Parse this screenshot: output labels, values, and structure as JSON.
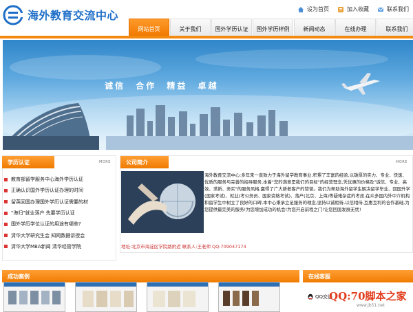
{
  "header": {
    "logo_text": "海外教育交流中心",
    "links": [
      {
        "label": "设为首页",
        "icon": "home-icon"
      },
      {
        "label": "加入收藏",
        "icon": "bookmark-icon"
      },
      {
        "label": "联系我们",
        "icon": "contact-icon"
      }
    ]
  },
  "nav": {
    "items": [
      "网站首页",
      "关于我们",
      "国外学历认证",
      "国外学历样例",
      "新闻动态",
      "在线办理",
      "联系我们"
    ],
    "active_index": 0
  },
  "banner": {
    "slogan": "诚信  合作  精益  卓越"
  },
  "left_module": {
    "title": "学历认证",
    "more": "MORE",
    "items": [
      "教育部留学服务中心海外学历认证",
      "正确认识国外学历认证办理的时间",
      "留英回国办理国外学历认证需要的材",
      "\"海归\"就业落户  先要学历认证",
      "国外学历学位认证的用途有哪些?",
      "清华大学研究生会  知网数据讲授会",
      "清华大学MBA新闻  清华经管学院"
    ]
  },
  "company": {
    "title": "公司简介",
    "more": "MORE",
    "text": "海外教育交流中心:多年来一直致力于海外留学教育事业,积累了丰富的经验,以雄厚的实力、专业、快速、优质的服务与完善的指导服务,本着\"您的满意是我们的目标\"的经营理念,凭优惠的价格及\"诚信、专业、高效、求新、务实\"的服务风格,赢得了广大新老客户的赞誉。我们为帮助海外留学生解决留学毕业、回国升学(国家考试)、就业(考公务员、国家资格考试)、落户(北京、上海)等疑难杂症的考虑,在众多国内外中介机构和留学生中树立了良好的口碑,本中心秉承立足服务的理念,坚持以诚相待,以信相待,互惠互利的合作基础,为您提供最完美的服务!为您增加成功的机会!为您开启前程之门!让您回国发展无忧!",
    "contact": "地址:北京市海淀区学院路附近  联系人:王老师  QQ:709047174"
  },
  "cases": {
    "title": "成功案例"
  },
  "service": {
    "title": "在线客服",
    "qq_label": "QQ交谈"
  },
  "watermark": {
    "text": "QQ:70脚本之家",
    "sub": "www.jb51.net"
  },
  "colors": {
    "accent": "#f28a10",
    "brand": "#1f6fc8"
  }
}
